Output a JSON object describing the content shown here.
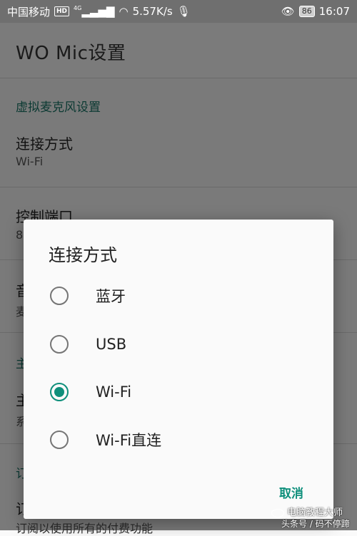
{
  "status_bar": {
    "carrier": "中国移动",
    "hd": "HD",
    "network_label": "4G",
    "speed": "5.57K/s",
    "battery": "86",
    "time": "16:07"
  },
  "app_bar": {
    "title": "WO Mic设置"
  },
  "settings": {
    "category_virtual_mic": "虚拟麦克风设置",
    "conn_title": "连接方式",
    "conn_value": "Wi-Fi",
    "port_title": "控制端口",
    "port_value_partial": "8",
    "audio_title_partial": "音",
    "audio_sub_partial": "麦",
    "category2_partial": "主",
    "theme_title_partial": "主",
    "theme_sub_partial": "系",
    "category3_partial": "订",
    "sub_title_partial": "订",
    "sub_desc": "订阅以使用所有的付费功能"
  },
  "dialog": {
    "title": "连接方式",
    "options": [
      {
        "label": "蓝牙",
        "selected": false
      },
      {
        "label": "USB",
        "selected": false
      },
      {
        "label": "Wi-Fi",
        "selected": true
      },
      {
        "label": "Wi-Fi直连",
        "selected": false
      }
    ],
    "cancel": "取消",
    "accent_color": "#0e8f7b"
  },
  "watermark": {
    "line1": "电脑教程大师",
    "line2": "头条号 / 码不停蹄"
  }
}
